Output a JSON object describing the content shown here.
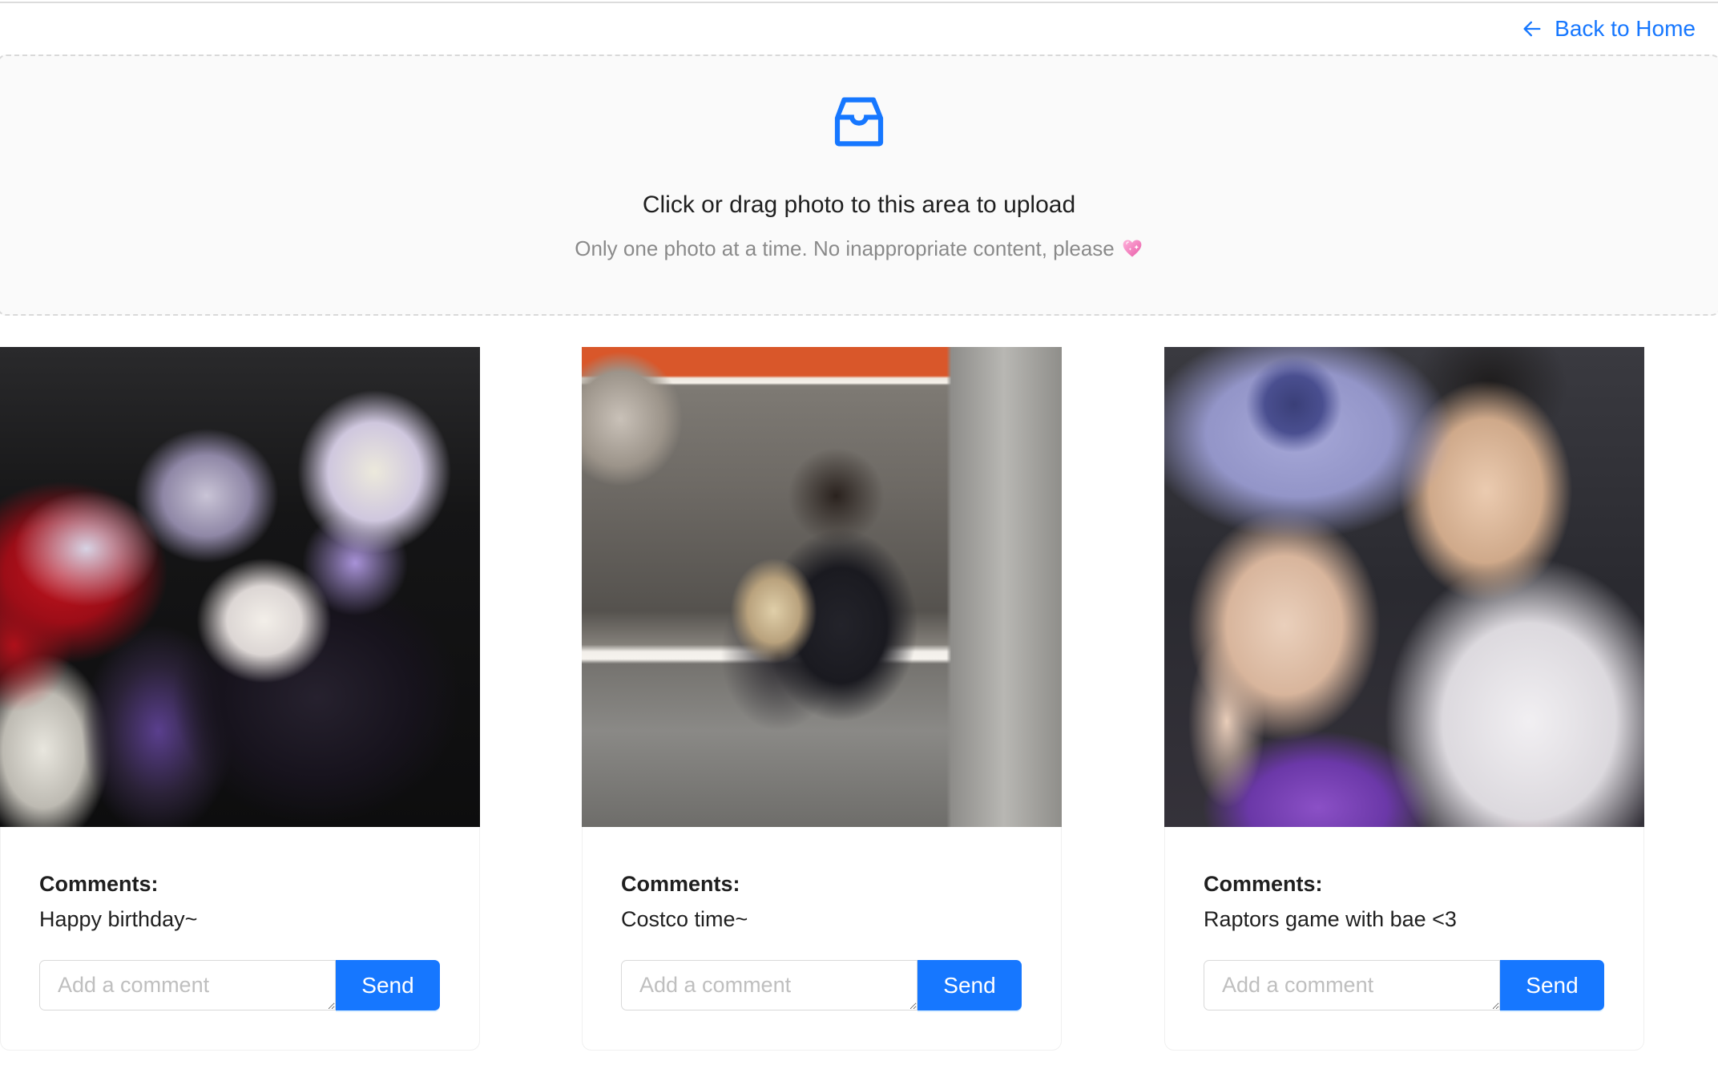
{
  "header": {
    "back_label": "Back to Home",
    "back_icon": "arrow-left-icon"
  },
  "upload": {
    "icon": "inbox-icon",
    "text": "Click or drag photo to this area to upload",
    "hint": "Only one photo at a time. No inappropriate content, please",
    "hint_icon": "sparkling-heart-icon"
  },
  "cards": [
    {
      "comments_label": "Comments:",
      "comment": "Happy birthday~",
      "input_placeholder": "Add a comment",
      "send_label": "Send"
    },
    {
      "comments_label": "Comments:",
      "comment": "Costco time~",
      "input_placeholder": "Add a comment",
      "send_label": "Send"
    },
    {
      "comments_label": "Comments:",
      "comment": "Raptors game with bae <3",
      "input_placeholder": "Add a comment",
      "send_label": "Send"
    }
  ],
  "colors": {
    "accent": "#1677ff",
    "dragger_background": "#fafafa",
    "dragger_border": "#d9d9d9",
    "hint_text": "#8c8c8c",
    "card_border": "#f0f0f0"
  }
}
